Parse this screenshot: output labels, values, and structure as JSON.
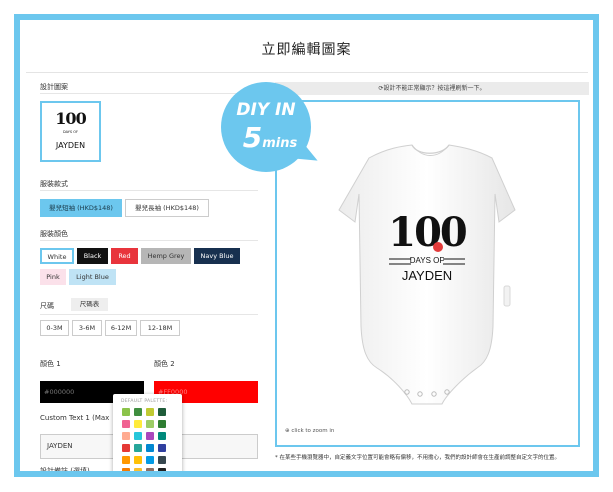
{
  "page": {
    "title": "立即編輯圖案"
  },
  "left": {
    "design_section_label": "設計圖案",
    "design_thumb": {
      "number": "100",
      "subline": "DAYS OF",
      "name": "JAYDEN"
    },
    "style_label": "服裝款式",
    "styles": [
      {
        "label": "嬰兒短袖 (HKD$148)",
        "active": true
      },
      {
        "label": "嬰兒長袖 (HKD$148)",
        "active": false
      }
    ],
    "color_label": "服裝顏色",
    "colors_row1": [
      {
        "label": "White",
        "bg": "#ffffff",
        "fg": "#333333",
        "selected": true
      },
      {
        "label": "Black",
        "bg": "#111111",
        "fg": "#ffffff",
        "selected": false
      },
      {
        "label": "Red",
        "bg": "#e8343c",
        "fg": "#ffffff",
        "selected": false
      },
      {
        "label": "Hemp Grey",
        "bg": "#b6b6b6",
        "fg": "#333333",
        "selected": false
      },
      {
        "label": "Navy Blue",
        "bg": "#17304f",
        "fg": "#ffffff",
        "selected": false
      }
    ],
    "colors_row2": [
      {
        "label": "Pink",
        "bg": "#fbe1ea",
        "fg": "#333333",
        "selected": false
      },
      {
        "label": "Light Blue",
        "bg": "#bfe3f5",
        "fg": "#333333",
        "selected": false
      }
    ],
    "size_label": "尺碼",
    "size_chart_label": "尺碼表",
    "sizes": [
      "0-3M",
      "3-6M",
      "6-12M",
      "12-18M"
    ],
    "color1_label": "顏色 1",
    "color1_value": "#000000",
    "color1_hex": "#000000",
    "color2_label": "顏色 2",
    "color2_value": "#FF0000",
    "color2_hex": "#ff0000",
    "custom_text_label": "Custom Text 1 (Max",
    "custom_text_value": "JAYDEN",
    "remark_label": "設計備註 (選填)",
    "palette": {
      "label": "DEFAULT PALETTE:",
      "colors": [
        "#8bc34a",
        "#3f8e3f",
        "#c0ca33",
        "#1f5c3a",
        "#f06292",
        "#ffeb3b",
        "#9ccc65",
        "#2e7d32",
        "#ffab91",
        "#26c6da",
        "#ab47bc",
        "#00897b",
        "#e53935",
        "#26a69a",
        "#0288d1",
        "#303f9f",
        "#ff9800",
        "#ffc107",
        "#039be5",
        "#37474f",
        "#f57c00",
        "#fbc02d",
        "#8d6e63",
        "#212121",
        "#ef6c00",
        "#d4a017",
        "#ce93d8",
        "#5d4037"
      ]
    }
  },
  "right": {
    "reset_bar": "⟳設計不能正常顯示？按這裡刷新一下。",
    "preview": {
      "number": "100",
      "subline": "DAYS OF",
      "name": "JAYDEN",
      "zoom_hint": "click to zoom in"
    },
    "notice": "* 在某些手機瀏覽器中，自定義文字位置可能會略有偏移，不用擔心，我們的設計師會在生產前調整自定文字的位置。"
  },
  "badge": {
    "line1": "DIY IN",
    "line2_big": "5",
    "line2_small": "mins",
    "color": "#6cc7ee"
  }
}
